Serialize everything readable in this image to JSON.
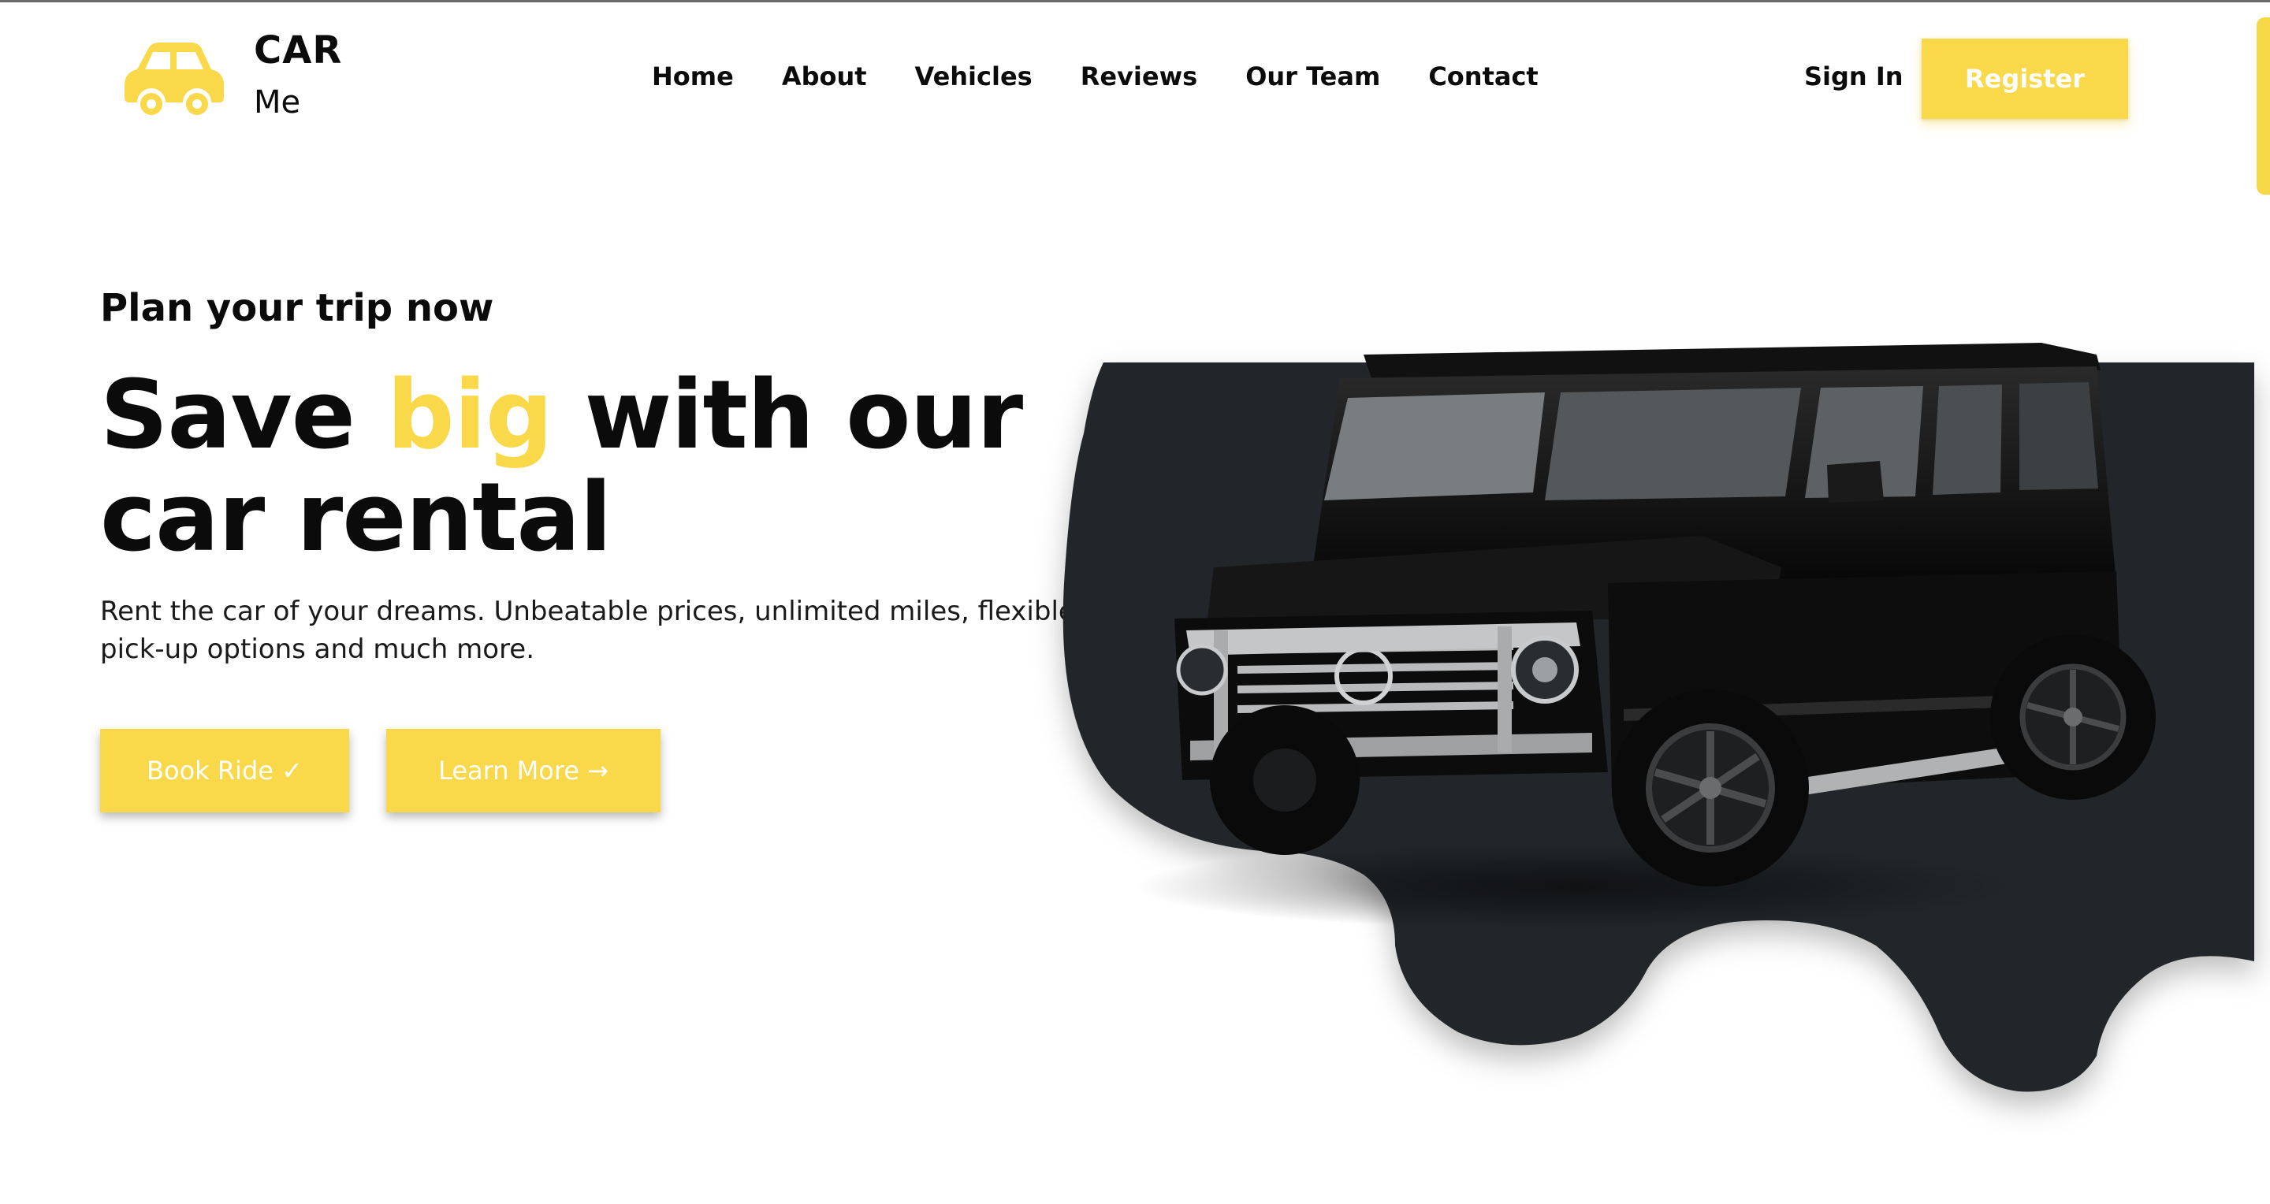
{
  "brand": {
    "line1": "CAR",
    "line2": "Me",
    "icon": "car-icon",
    "color": "#f9d84a"
  },
  "nav": {
    "items": [
      "Home",
      "About",
      "Vehicles",
      "Reviews",
      "Our Team",
      "Contact"
    ]
  },
  "auth": {
    "sign_in": "Sign In",
    "register": "Register"
  },
  "hero": {
    "eyebrow": "Plan your trip now",
    "headline_part1": "Save ",
    "headline_accent": "big",
    "headline_part2": " with our car rental",
    "description": "Rent the car of your dreams. Unbeatable prices, unlimited miles, flexible pick-up options and much more.",
    "book_button": "Book Ride ✓",
    "learn_button": "Learn More →",
    "image": "black-suv-image"
  },
  "colors": {
    "accent": "#f9d84a",
    "dark_blob": "#23262a",
    "text": "#0b0b0b"
  }
}
